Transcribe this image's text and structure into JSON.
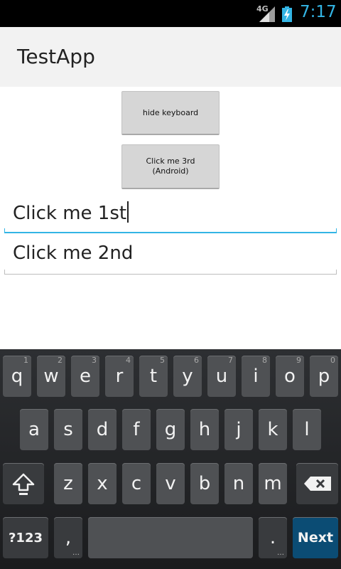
{
  "status_bar": {
    "network": "4G",
    "time": "7:17",
    "icons": [
      "signal-icon",
      "battery-charging-icon"
    ]
  },
  "app": {
    "title": "TestApp"
  },
  "buttons": {
    "hide_keyboard": "hide keyboard",
    "click_3rd_line1": "Click me 3rd",
    "click_3rd_line2": "(Android)"
  },
  "fields": {
    "first": "Click me 1st",
    "second": "Click me 2nd"
  },
  "keyboard": {
    "row1": [
      {
        "label": "q",
        "hint": "1"
      },
      {
        "label": "w",
        "hint": "2"
      },
      {
        "label": "e",
        "hint": "3"
      },
      {
        "label": "r",
        "hint": "4"
      },
      {
        "label": "t",
        "hint": "5"
      },
      {
        "label": "y",
        "hint": "6"
      },
      {
        "label": "u",
        "hint": "7"
      },
      {
        "label": "i",
        "hint": "8"
      },
      {
        "label": "o",
        "hint": "9"
      },
      {
        "label": "p",
        "hint": "0"
      }
    ],
    "row2": [
      "a",
      "s",
      "d",
      "f",
      "g",
      "h",
      "j",
      "k",
      "l"
    ],
    "row3": [
      "z",
      "x",
      "c",
      "v",
      "b",
      "n",
      "m"
    ],
    "symbols_label": "?123",
    "comma": ",",
    "period": ".",
    "enter_label": "Next",
    "colors": {
      "enter": "#0b4c74",
      "accent": "#33b5e5"
    }
  }
}
